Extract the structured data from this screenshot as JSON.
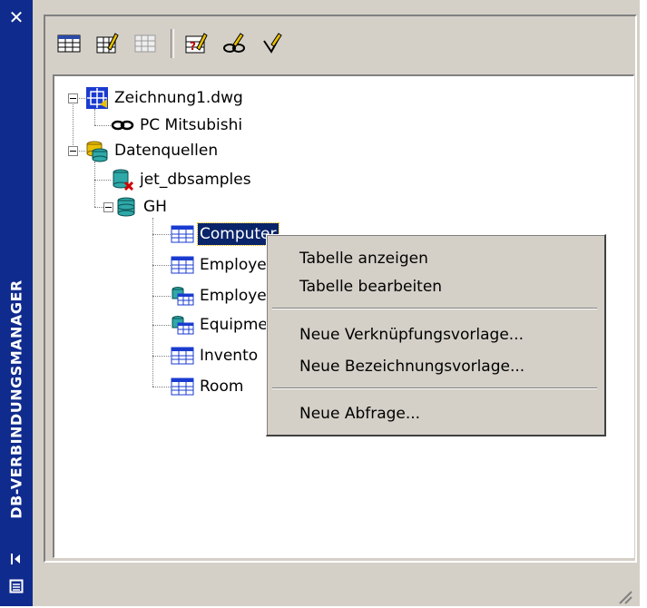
{
  "palette": {
    "title": "DB-VERBINDUNGSMANAGER",
    "titlebar_color": "#102b8e",
    "close_glyph": "✕"
  },
  "toolbar": {
    "buttons": [
      {
        "icon": "view-table-icon"
      },
      {
        "icon": "edit-table-icon"
      },
      {
        "icon": "synchronize-icon"
      },
      {
        "icon": "query-editor-icon"
      },
      {
        "icon": "link-template-icon"
      },
      {
        "icon": "label-template-icon"
      }
    ]
  },
  "tree": {
    "drawing": {
      "label": "Zeichnung1.dwg",
      "icon": "drawing-icon"
    },
    "link": {
      "label": "PC Mitsubishi",
      "icon": "link-icon"
    },
    "datasources": {
      "label": "Datenquellen",
      "icon": "datasources-icon"
    },
    "jet": {
      "label": "jet_dbsamples",
      "icon": "datasource-disconnected-icon"
    },
    "gh": {
      "label": "GH",
      "icon": "datasource-icon"
    },
    "tables": [
      {
        "label": "Computer",
        "icon": "table-icon",
        "selected": true
      },
      {
        "label": "Employe",
        "icon": "table-icon"
      },
      {
        "label": "Employe",
        "icon": "view-icon"
      },
      {
        "label": "Equipme",
        "icon": "view-icon"
      },
      {
        "label": "Invento",
        "icon": "table-icon"
      },
      {
        "label": "Room",
        "icon": "table-icon"
      }
    ]
  },
  "context_menu": {
    "items": [
      "Tabelle anzeigen",
      "Tabelle bearbeiten",
      "Neue Verknüpfungsvorlage...",
      "Neue Bezeichnungsvorlage...",
      "Neue Abfrage..."
    ]
  },
  "colors": {
    "selection": "#0a246a",
    "panel_bg": "#d4d0c8"
  }
}
